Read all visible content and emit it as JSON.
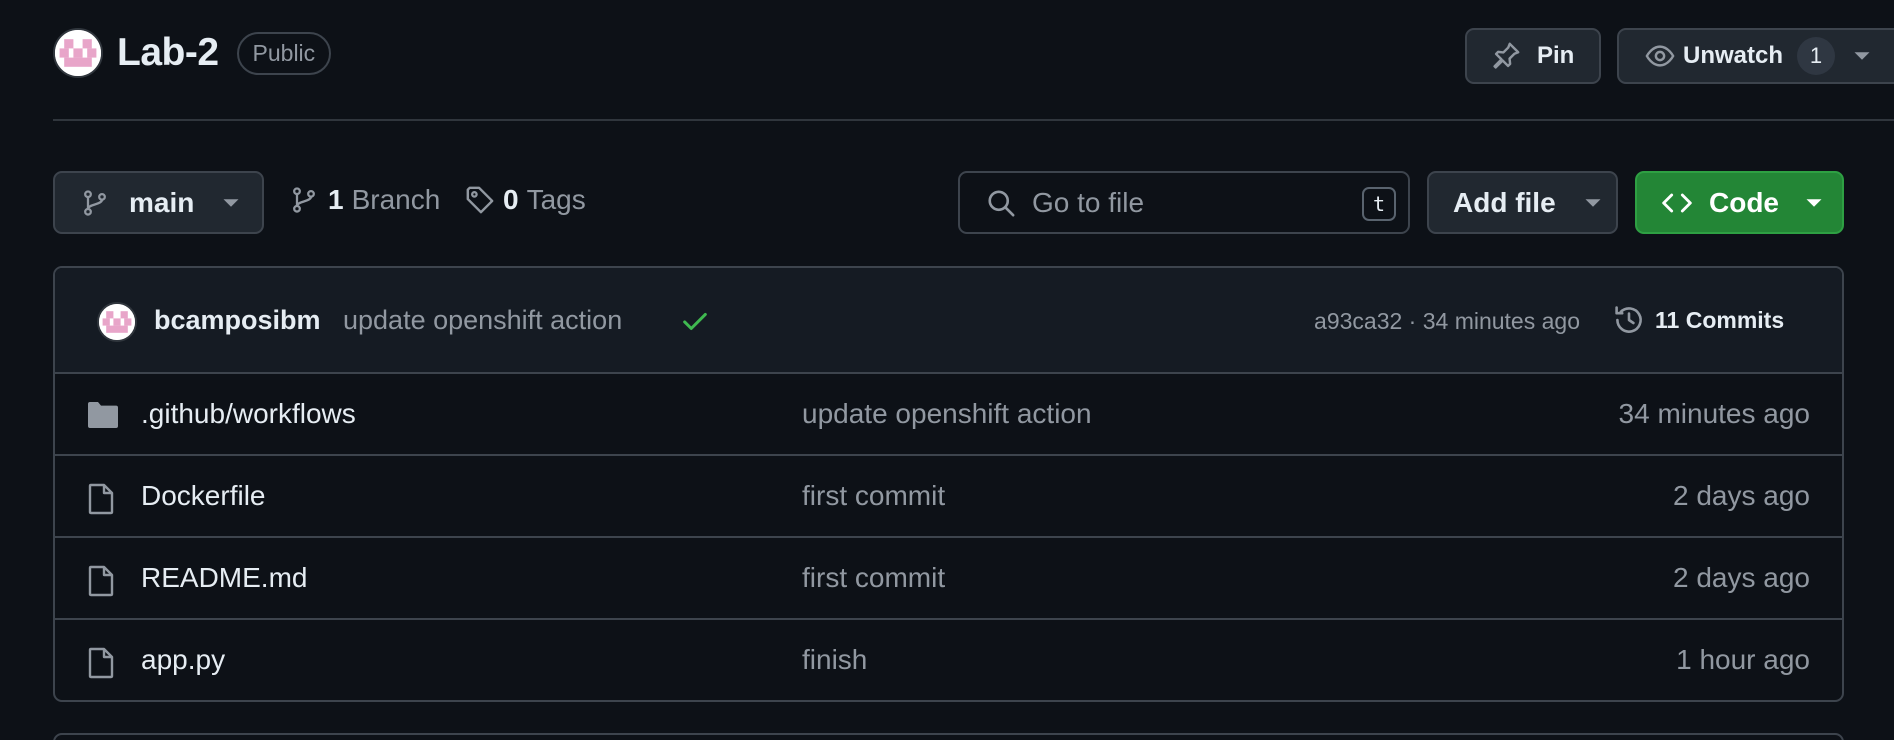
{
  "repo": {
    "name": "Lab-2",
    "visibility": "Public",
    "avatar_icon": "identicon-avatar"
  },
  "header_actions": {
    "pin_label": "Pin",
    "watch_label": "Unwatch",
    "watch_count": "1"
  },
  "toolbar": {
    "branch_name": "main",
    "branch_count": "1",
    "branch_label": "Branch",
    "tag_count": "0",
    "tag_label": "Tags",
    "search_placeholder": "Go to file",
    "search_shortcut": "t",
    "add_file_label": "Add file",
    "code_label": "Code"
  },
  "latest_commit": {
    "author": "bcamposibm",
    "message": "update openshift action",
    "status": "success",
    "hash_and_time": "a93ca32 · 34 minutes ago",
    "commits_label": "11 Commits"
  },
  "files": [
    {
      "type": "folder",
      "name": ".github/workflows",
      "commit": "update openshift action",
      "age": "34 minutes ago"
    },
    {
      "type": "file",
      "name": "Dockerfile",
      "commit": "first commit",
      "age": "2 days ago"
    },
    {
      "type": "file",
      "name": "README.md",
      "commit": "first commit",
      "age": "2 days ago"
    },
    {
      "type": "file",
      "name": "app.py",
      "commit": "finish",
      "age": "1 hour ago"
    }
  ],
  "colors": {
    "background": "#0d1117",
    "border": "#3d444d",
    "muted_text": "#9198a1",
    "primary_button": "#238636",
    "success_check": "#3fb950",
    "avatar_pink": "#e8a5c9"
  }
}
